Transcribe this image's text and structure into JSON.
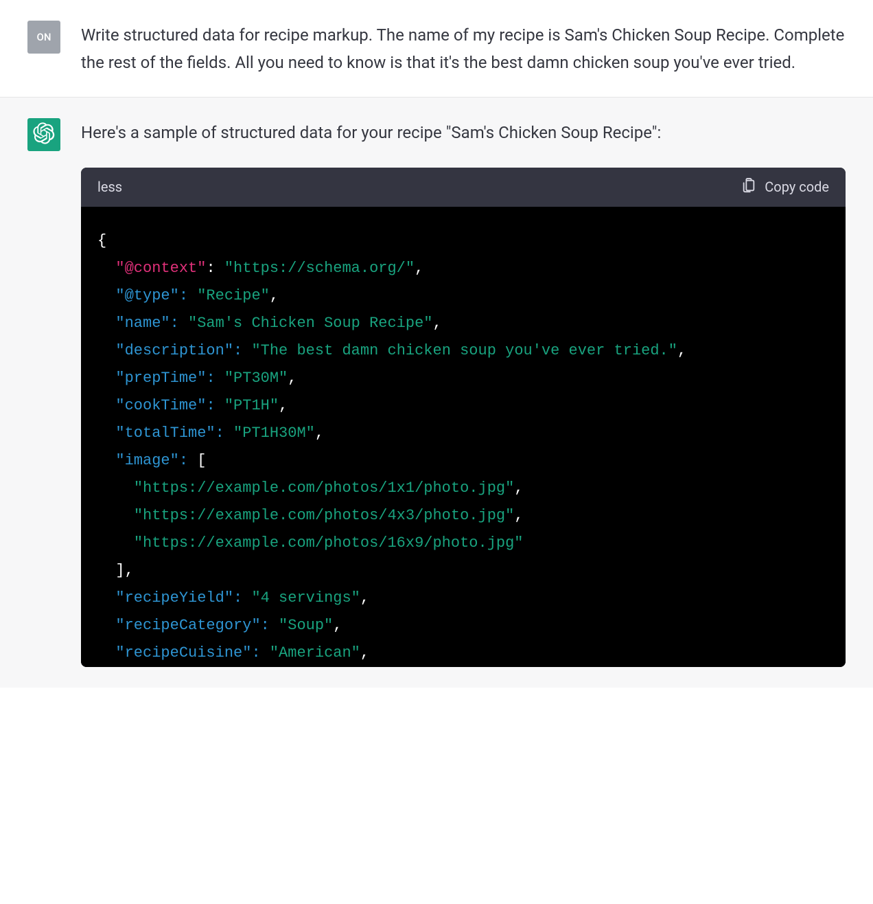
{
  "user": {
    "avatar_label": "ON",
    "message": "Write structured data for recipe markup. The name of my recipe is Sam's Chicken Soup Recipe. Complete the rest of the fields. All you need to know is that it's the best damn chicken soup you've ever tried."
  },
  "assistant": {
    "intro_text": "Here's a sample of structured data for your recipe \"Sam's Chicken Soup Recipe\":",
    "code_lang": "less",
    "copy_label": "Copy code",
    "code": {
      "context_key": "\"@context\"",
      "context_val": "\"https://schema.org/\"",
      "type_key": "\"@type\"",
      "type_val": "\"Recipe\"",
      "name_key": "\"name\"",
      "name_val": "\"Sam's Chicken Soup Recipe\"",
      "description_key": "\"description\"",
      "description_val": "\"The best damn chicken soup you've ever tried.\"",
      "prepTime_key": "\"prepTime\"",
      "prepTime_val": "\"PT30M\"",
      "cookTime_key": "\"cookTime\"",
      "cookTime_val": "\"PT1H\"",
      "totalTime_key": "\"totalTime\"",
      "totalTime_val": "\"PT1H30M\"",
      "image_key": "\"image\"",
      "image_arr_0": "\"https://example.com/photos/1x1/photo.jpg\"",
      "image_arr_1": "\"https://example.com/photos/4x3/photo.jpg\"",
      "image_arr_2": "\"https://example.com/photos/16x9/photo.jpg\"",
      "recipeYield_key": "\"recipeYield\"",
      "recipeYield_val": "\"4 servings\"",
      "recipeCategory_key": "\"recipeCategory\"",
      "recipeCategory_val": "\"Soup\"",
      "recipeCuisine_key": "\"recipeCuisine\"",
      "recipeCuisine_val": "\"American\""
    }
  }
}
